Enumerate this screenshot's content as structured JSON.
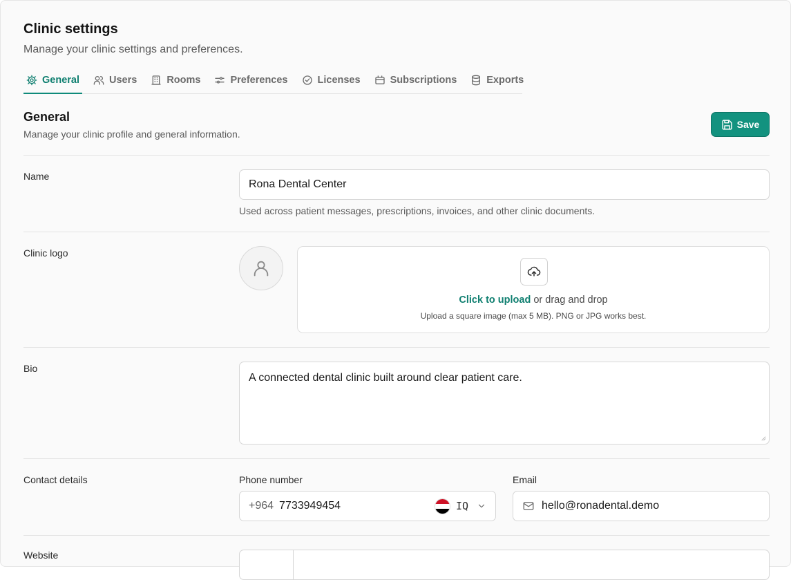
{
  "header": {
    "title": "Clinic settings",
    "subtitle": "Manage your clinic settings and preferences."
  },
  "tabs": [
    {
      "label": "General",
      "icon": "gear-icon",
      "active": true
    },
    {
      "label": "Users",
      "icon": "users-icon",
      "active": false
    },
    {
      "label": "Rooms",
      "icon": "building-icon",
      "active": false
    },
    {
      "label": "Preferences",
      "icon": "sliders-icon",
      "active": false
    },
    {
      "label": "Licenses",
      "icon": "check-circle-icon",
      "active": false
    },
    {
      "label": "Subscriptions",
      "icon": "card-icon",
      "active": false
    },
    {
      "label": "Exports",
      "icon": "database-icon",
      "active": false
    }
  ],
  "section": {
    "title": "General",
    "subtitle": "Manage your clinic profile and general information.",
    "save_label": "Save"
  },
  "name_row": {
    "label": "Name",
    "value": "Rona Dental Center",
    "help": "Used across patient messages, prescriptions, invoices, and other clinic documents."
  },
  "logo_row": {
    "label": "Clinic logo",
    "upload_link": "Click to upload",
    "upload_rest": " or drag and drop",
    "upload_hint": "Upload a square image (max 5 MB). PNG or JPG works best."
  },
  "bio_row": {
    "label": "Bio",
    "value": "A connected dental clinic built around clear patient care."
  },
  "contact_row": {
    "label": "Contact details",
    "phone_label": "Phone number",
    "phone_prefix": "+964",
    "phone_value": "7733949454",
    "country_code": "IQ",
    "email_label": "Email",
    "email_value": "hello@ronadental.demo"
  },
  "website_row": {
    "label": "Website"
  },
  "colors": {
    "accent": "#13927f",
    "accent_text": "#0f7f70",
    "flag": [
      "#ce1126",
      "#ffffff",
      "#000000"
    ]
  }
}
